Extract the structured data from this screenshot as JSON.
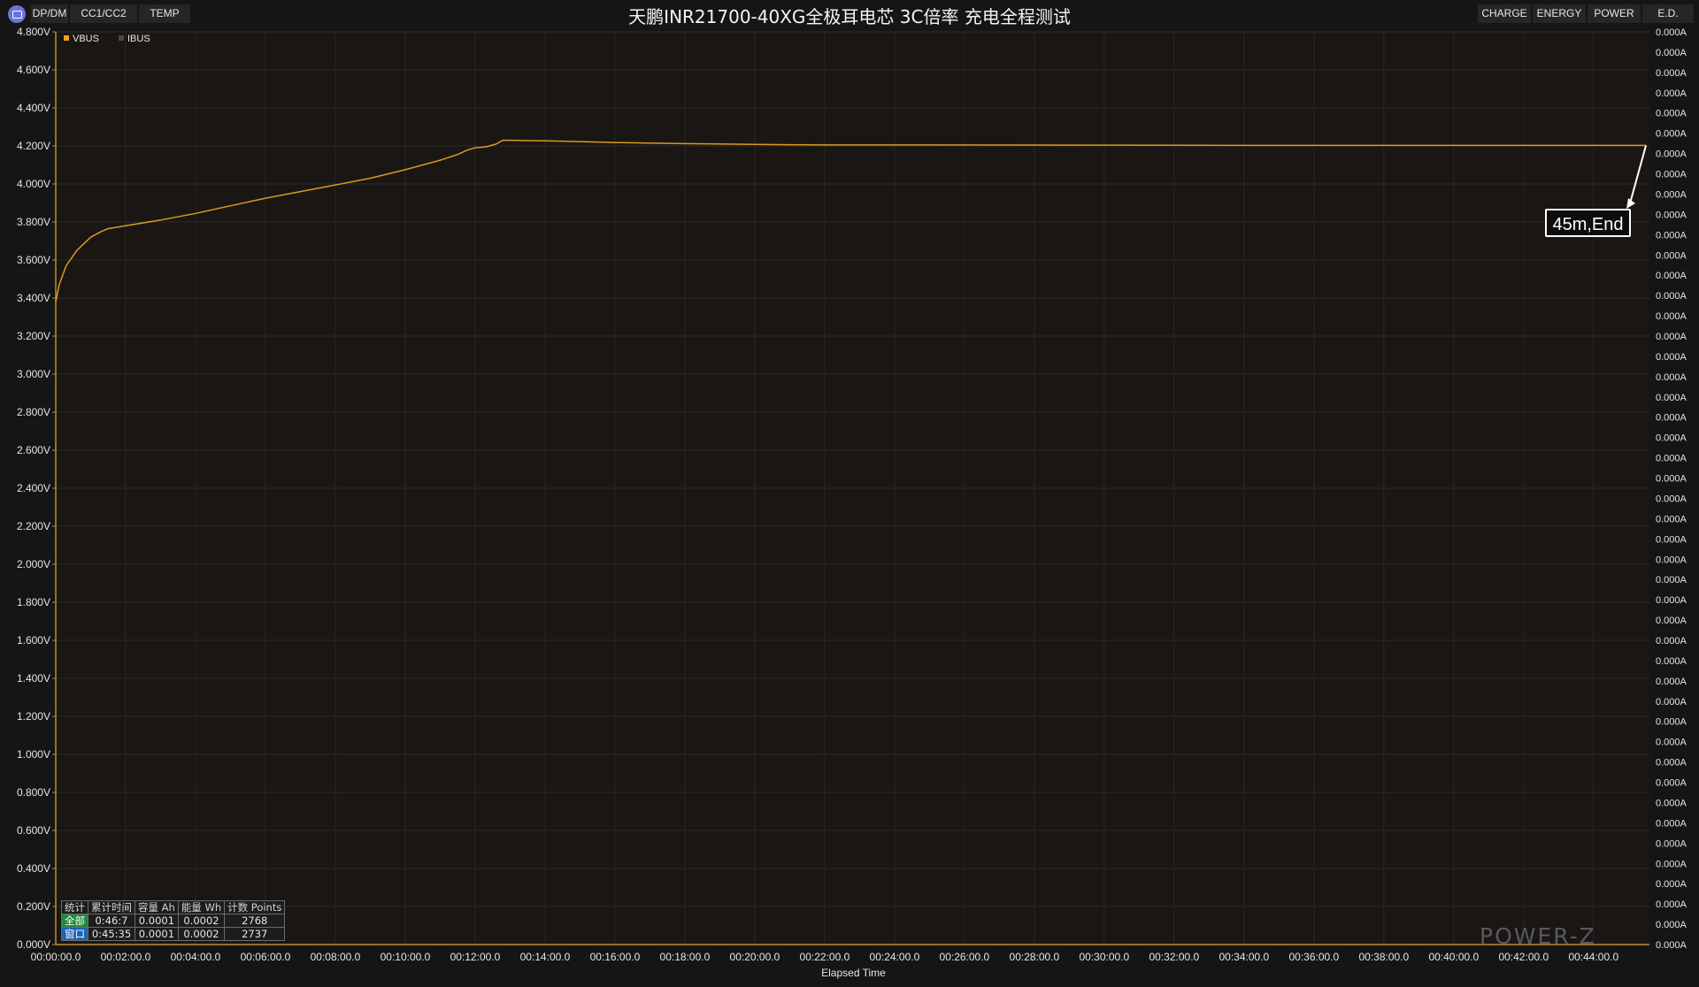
{
  "toolbar": {
    "left_tabs": [
      "DP/DM",
      "CC1/CC2",
      "TEMP"
    ],
    "right_tabs": [
      "CHARGE",
      "ENERGY",
      "POWER",
      "E.D."
    ]
  },
  "chart_data": {
    "type": "line",
    "title": "天鹏INR21700-40XG全极耳电芯 3C倍率 充电全程测试",
    "xlabel": "Elapsed Time",
    "ylabel_left": "",
    "ylabel_right": "",
    "x_ticks": [
      "00:00:00.0",
      "00:02:00.0",
      "00:04:00.0",
      "00:06:00.0",
      "00:08:00.0",
      "00:10:00.0",
      "00:12:00.0",
      "00:14:00.0",
      "00:16:00.0",
      "00:18:00.0",
      "00:20:00.0",
      "00:22:00.0",
      "00:24:00.0",
      "00:26:00.0",
      "00:28:00.0",
      "00:30:00.0",
      "00:32:00.0",
      "00:34:00.0",
      "00:36:00.0",
      "00:38:00.0",
      "00:40:00.0",
      "00:42:00.0",
      "00:44:00.0"
    ],
    "y_left_ticks": [
      "4.800V",
      "4.600V",
      "4.400V",
      "4.200V",
      "4.000V",
      "3.800V",
      "3.600V",
      "3.400V",
      "3.200V",
      "3.000V",
      "2.800V",
      "2.600V",
      "2.400V",
      "2.200V",
      "2.000V",
      "1.800V",
      "1.600V",
      "1.400V",
      "1.200V",
      "1.000V",
      "0.800V",
      "0.600V",
      "0.400V",
      "0.200V",
      "0.000V"
    ],
    "y_right_ticks": [
      "0.000A",
      "0.000A",
      "0.000A",
      "0.000A",
      "0.000A",
      "0.000A",
      "0.000A",
      "0.000A",
      "0.000A",
      "0.000A",
      "0.000A",
      "0.000A",
      "0.000A",
      "0.000A",
      "0.000A",
      "0.000A",
      "0.000A",
      "0.000A",
      "0.000A",
      "0.000A",
      "0.000A",
      "0.000A",
      "0.000A",
      "0.000A",
      "0.000A",
      "0.000A",
      "0.000A",
      "0.000A",
      "0.000A",
      "0.000A",
      "0.000A",
      "0.000A",
      "0.000A",
      "0.000A",
      "0.000A",
      "0.000A",
      "0.000A",
      "0.000A",
      "0.000A",
      "0.000A",
      "0.000A",
      "0.000A",
      "0.000A",
      "0.000A",
      "0.000A",
      "0.000A"
    ],
    "xlim_min": [
      0,
      45.6
    ],
    "ylim_left": [
      0,
      4.8
    ],
    "legend": {
      "placement": "top-left",
      "items": [
        {
          "name": "VBUS",
          "color": "#f0a020"
        },
        {
          "name": "IBUS",
          "color": "#4a4a4a"
        }
      ]
    },
    "series": [
      {
        "name": "VBUS",
        "color": "#d99a1e",
        "x_min": [
          0,
          0.1,
          0.3,
          0.6,
          1.0,
          1.3,
          1.5,
          2,
          3,
          4,
          5,
          6,
          7,
          8,
          9,
          10,
          10.5,
          11,
          11.5,
          11.8,
          12.0,
          12.3,
          12.6,
          12.8,
          14,
          16,
          18,
          20,
          22,
          25,
          30,
          35,
          40,
          45.5
        ],
        "values": [
          3.38,
          3.47,
          3.57,
          3.65,
          3.72,
          3.75,
          3.765,
          3.78,
          3.81,
          3.845,
          3.885,
          3.925,
          3.96,
          3.995,
          4.03,
          4.075,
          4.1,
          4.125,
          4.155,
          4.18,
          4.19,
          4.195,
          4.21,
          4.23,
          4.227,
          4.218,
          4.212,
          4.208,
          4.205,
          4.205,
          4.204,
          4.203,
          4.203,
          4.203
        ]
      },
      {
        "name": "IBUS",
        "color": "#4a4a4a",
        "x_min": [],
        "values": []
      }
    ],
    "annotation": {
      "text": "45m,End",
      "x_min": 45.5,
      "y": 4.203
    },
    "grid": true
  },
  "stats": {
    "headers": [
      "统计",
      "累计时间",
      "容量 Ah",
      "能量 Wh",
      "计数 Points"
    ],
    "rows": [
      {
        "label": "全部",
        "time": "0:46:7",
        "capacity": "0.0001",
        "energy": "0.0002",
        "points": "2768"
      },
      {
        "label": "窗口",
        "time": "0:45:35",
        "capacity": "0.0001",
        "energy": "0.0002",
        "points": "2737"
      }
    ]
  },
  "watermark": "POWER-Z"
}
